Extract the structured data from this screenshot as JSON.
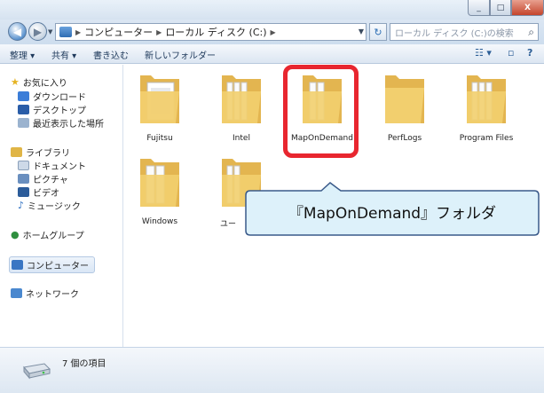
{
  "window": {
    "controls": {
      "minimize": "_",
      "maximize": "□",
      "close": "X"
    }
  },
  "address_bar": {
    "back_glyph": "◀",
    "forward_glyph": "▶",
    "breadcrumb": [
      "コンピューター",
      "ローカル ディスク (C:)"
    ],
    "search_placeholder": "ローカル ディスク (C:)の検索",
    "refresh_glyph": "↻",
    "search_glyph": "⌕"
  },
  "toolbar": {
    "organize": "整理 ▾",
    "share": "共有 ▾",
    "burn": "書き込む",
    "new_folder": "新しいフォルダー",
    "view_glyph": "☷ ▾",
    "pane_glyph": "▫",
    "help_glyph": "?"
  },
  "nav_pane": {
    "favorites": "お気に入り",
    "downloads": "ダウンロード",
    "desktop": "デスクトップ",
    "recent": "最近表示した場所",
    "libraries": "ライブラリ",
    "documents": "ドキュメント",
    "pictures": "ピクチャ",
    "videos": "ビデオ",
    "music": "ミュージック",
    "homegroup": "ホームグループ",
    "computer": "コンピューター",
    "network": "ネットワーク"
  },
  "folders": [
    "Fujitsu",
    "Intel",
    "MapOnDemand",
    "PerfLogs",
    "Program Files",
    "Windows",
    "ユー"
  ],
  "callout": {
    "text": "『MapOnDemand』フォルダ"
  },
  "details": {
    "item_count": "7 個の項目"
  },
  "colors": {
    "highlight": "#e8262f",
    "callout_fill": "#ddf1fa",
    "callout_stroke": "#3a5a8a",
    "folder_fill": "#f2cf6e"
  }
}
